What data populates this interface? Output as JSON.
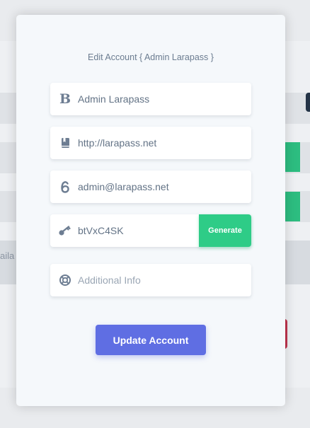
{
  "background": {
    "partial_text": "aila"
  },
  "modal": {
    "title": "Edit Account { Admin Larapass }",
    "fields": [
      {
        "icon": "bold-b-icon",
        "value": "Admin Larapass"
      },
      {
        "icon": "bookmark-icon",
        "value": "http://larapass.net"
      },
      {
        "icon": "email-at-icon",
        "value": "admin@larapass.net"
      },
      {
        "icon": "key-icon",
        "value": "btVxC4SK"
      },
      {
        "icon": "life-ring-icon",
        "placeholder": "Additional Info",
        "value": ""
      }
    ],
    "generate_label": "Generate",
    "update_label": "Update Account"
  },
  "colors": {
    "accent": "#5f6ee3",
    "success": "#2ecc87",
    "text": "#637386"
  }
}
